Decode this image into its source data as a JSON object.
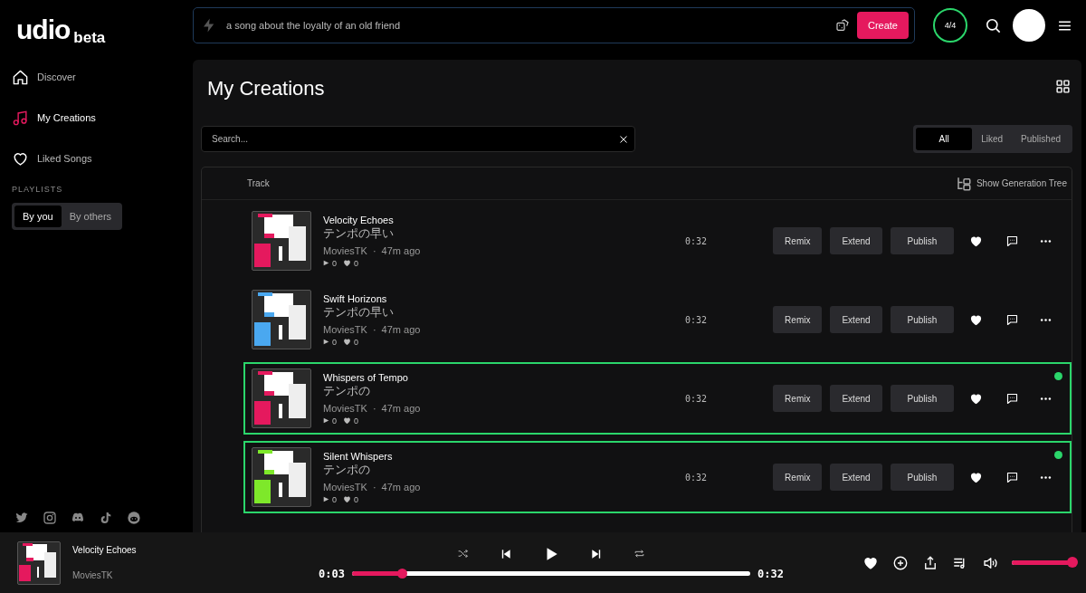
{
  "logo": {
    "name": "udio",
    "tag": "beta"
  },
  "sidebar": {
    "items": [
      {
        "label": "Discover",
        "selected": false
      },
      {
        "label": "My Creations",
        "selected": true
      },
      {
        "label": "Liked Songs",
        "selected": false
      }
    ],
    "playlists_heading": "PLAYLISTS",
    "playlist_tabs": [
      {
        "label": "By you",
        "selected": true
      },
      {
        "label": "By others",
        "selected": false
      }
    ]
  },
  "prompt": {
    "placeholder": "a song about the loyalty of an old friend",
    "button": "Create"
  },
  "credits": "4/4",
  "page": {
    "title": "My Creations",
    "search": {
      "placeholder": "Search..."
    },
    "filters": [
      {
        "label": "All",
        "selected": true
      },
      {
        "label": "Liked",
        "selected": false
      },
      {
        "label": "Published",
        "selected": false
      }
    ],
    "table": {
      "column_1": "Track",
      "tree_toggle": "Show Generation Tree",
      "rows": [
        {
          "title": "Velocity Echoes",
          "subtitle": "テンポの早い",
          "author": "MoviesTK",
          "separator": "·",
          "age": "47m ago",
          "plays": "0",
          "likes": "0",
          "duration": "0:32",
          "color": "#e5195e",
          "selected": false,
          "actions": [
            "Remix",
            "Extend",
            "Publish"
          ]
        },
        {
          "title": "Swift Horizons",
          "subtitle": "テンポの早い",
          "author": "MoviesTK",
          "separator": "·",
          "age": "47m ago",
          "plays": "0",
          "likes": "0",
          "duration": "0:32",
          "color": "#4aa8f0",
          "selected": false,
          "actions": [
            "Remix",
            "Extend",
            "Publish"
          ]
        },
        {
          "title": "Whispers of Tempo",
          "subtitle": "テンポの",
          "author": "MoviesTK",
          "separator": "·",
          "age": "47m ago",
          "plays": "0",
          "likes": "0",
          "duration": "0:32",
          "color": "#e5195e",
          "selected": true,
          "actions": [
            "Remix",
            "Extend",
            "Publish"
          ]
        },
        {
          "title": "Silent Whispers",
          "subtitle": "テンポの",
          "author": "MoviesTK",
          "separator": "·",
          "age": "47m ago",
          "plays": "0",
          "likes": "0",
          "duration": "0:32",
          "color": "#7ee82a",
          "selected": true,
          "actions": [
            "Remix",
            "Extend",
            "Publish"
          ]
        }
      ]
    }
  },
  "player": {
    "title": "Velocity Echoes",
    "artist": "MoviesTK",
    "color": "#e5195e",
    "elapsed": "0:03",
    "duration": "0:32",
    "progress": {
      "level": 0.125
    },
    "volume": {
      "level": 0.95
    }
  }
}
